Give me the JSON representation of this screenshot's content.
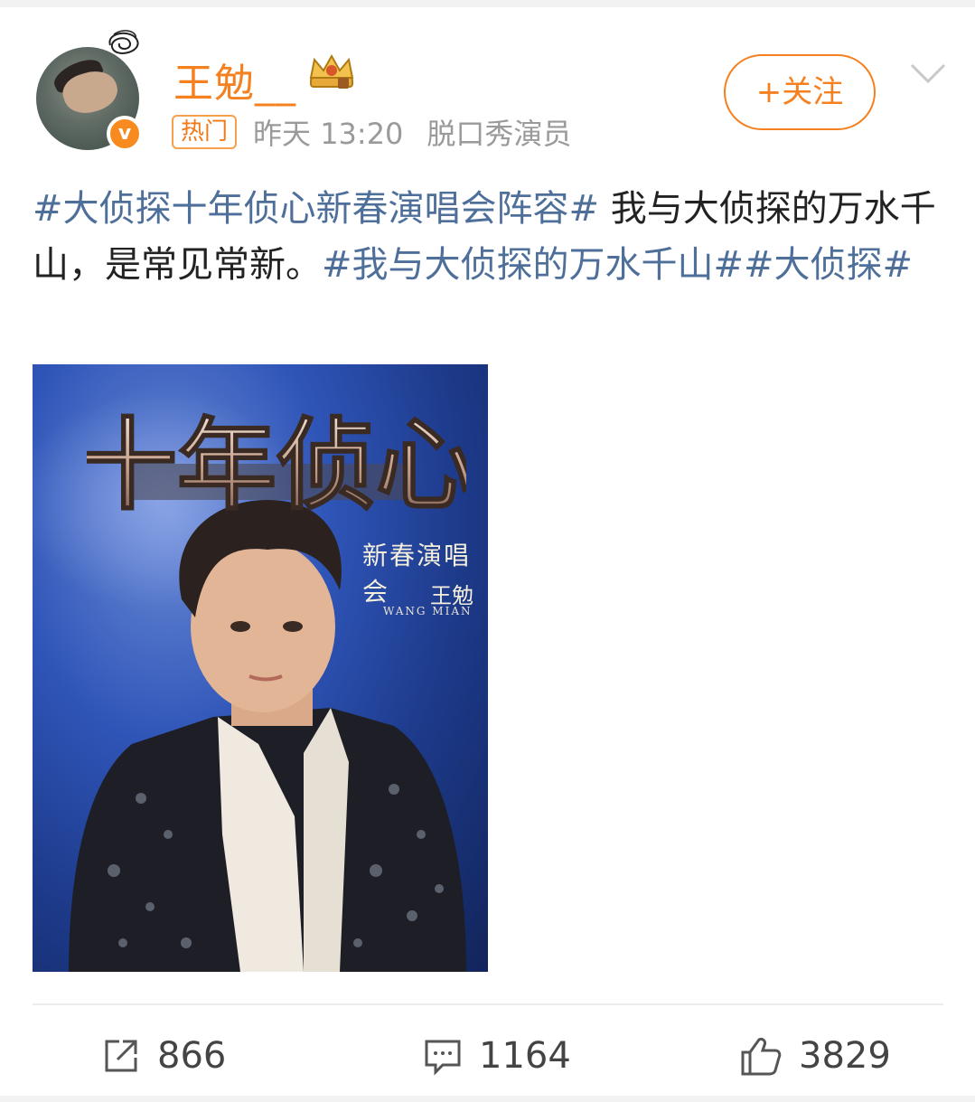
{
  "user": {
    "name": "王勉__",
    "hot_tag": "热门",
    "time": "昨天 13:20",
    "role": "脱口秀演员"
  },
  "follow": {
    "label": "+关注"
  },
  "post": {
    "topic1": "#大侦探十年侦心新春演唱会阵容#",
    "text1": " 我与大侦探的万水千山，是常见常新。",
    "topic2": "#我与大侦探的万水千山##大侦探#"
  },
  "poster": {
    "title": "十年侦心",
    "subtitle": "新春演唱会",
    "name": "王勉",
    "name_en": "WANG MIAN"
  },
  "actions": {
    "repost_count": "866",
    "comment_count": "1164",
    "like_count": "3829"
  },
  "colors": {
    "accent": "#f5801f",
    "topic": "#4f6f9b"
  }
}
